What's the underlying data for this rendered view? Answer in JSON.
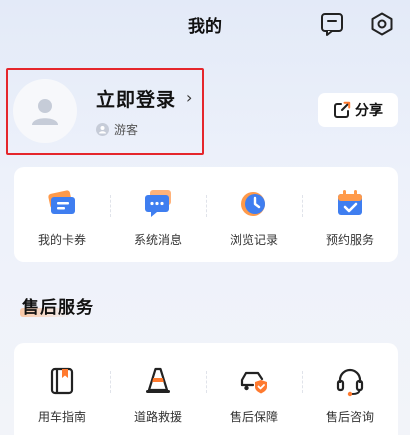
{
  "header": {
    "title": "我的",
    "message_icon": "message-square-icon",
    "settings_icon": "settings-hexagon-icon"
  },
  "profile": {
    "login_text": "立即登录",
    "arrow": "›",
    "guest_label": "游客"
  },
  "share": {
    "label": "分享"
  },
  "quick_menu": [
    {
      "label": "我的卡券",
      "icon": "coupon-icon"
    },
    {
      "label": "系统消息",
      "icon": "chat-bubble-icon"
    },
    {
      "label": "浏览记录",
      "icon": "history-clock-icon"
    },
    {
      "label": "预约服务",
      "icon": "calendar-check-icon"
    }
  ],
  "after_sales": {
    "title": "售后服务",
    "items": [
      {
        "label": "用车指南",
        "icon": "guide-book-icon"
      },
      {
        "label": "道路救援",
        "icon": "traffic-cone-icon"
      },
      {
        "label": "售后保障",
        "icon": "car-shield-icon"
      },
      {
        "label": "售后咨询",
        "icon": "headset-icon"
      }
    ]
  },
  "colors": {
    "accent_orange": "#ff7a2f",
    "accent_blue": "#3f7ef0",
    "highlight_red": "#e5262c"
  }
}
